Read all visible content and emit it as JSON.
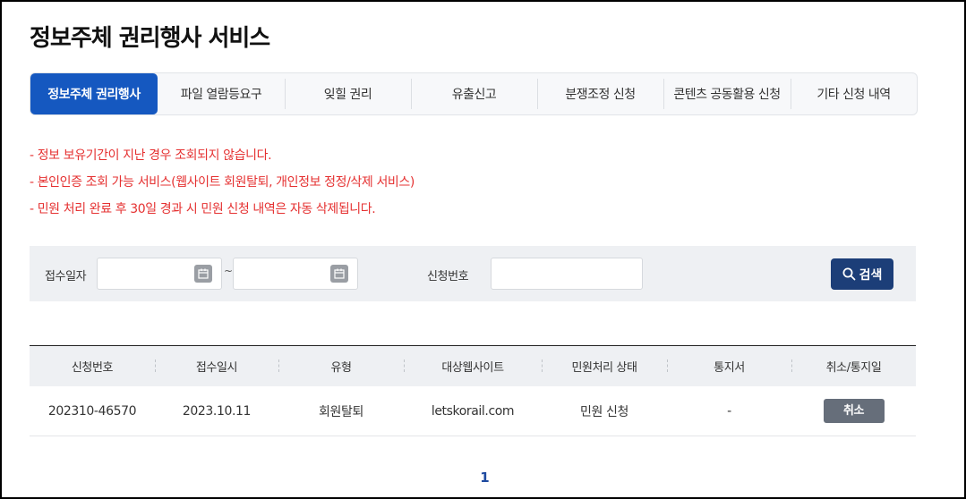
{
  "page": {
    "title": "정보주체 권리행사 서비스"
  },
  "tabs": [
    {
      "label": "정보주체 권리행사",
      "active": true
    },
    {
      "label": "파일 열람등요구",
      "active": false
    },
    {
      "label": "잊힐 권리",
      "active": false
    },
    {
      "label": "유출신고",
      "active": false
    },
    {
      "label": "분쟁조정 신청",
      "active": false
    },
    {
      "label": "콘텐츠 공동활용 신청",
      "active": false
    },
    {
      "label": "기타 신청 내역",
      "active": false
    }
  ],
  "notices": [
    "- 정보 보유기간이 지난 경우 조회되지 않습니다.",
    "- 본인인증 조회 가능 서비스(웹사이트 회원탈퇴, 개인정보 정정/삭제 서비스)",
    "- 민원 처리 완료 후 30일 경과 시 민원 신청 내역은 자동 삭제됩니다."
  ],
  "search": {
    "date_label": "접수일자",
    "date_from_value": "",
    "date_to_value": "",
    "date_separator": "~",
    "number_label": "신청번호",
    "number_value": "",
    "button_label": "검색"
  },
  "table": {
    "headers": [
      "신청번호",
      "접수일시",
      "유형",
      "대상웹사이트",
      "민원처리 상태",
      "통지서",
      "취소/통지일"
    ],
    "rows": [
      {
        "number": "202310-46570",
        "date": "2023.10.11",
        "type": "회원탈퇴",
        "site": "letskorail.com",
        "status": "민원 신청",
        "notice": "-",
        "action_label": "취소"
      }
    ]
  },
  "pagination": {
    "current_page": "1"
  },
  "colors": {
    "accent": "#1558c0",
    "search_button": "#1c3e78",
    "notice_text": "#e53131",
    "cancel_button": "#666e7a"
  }
}
